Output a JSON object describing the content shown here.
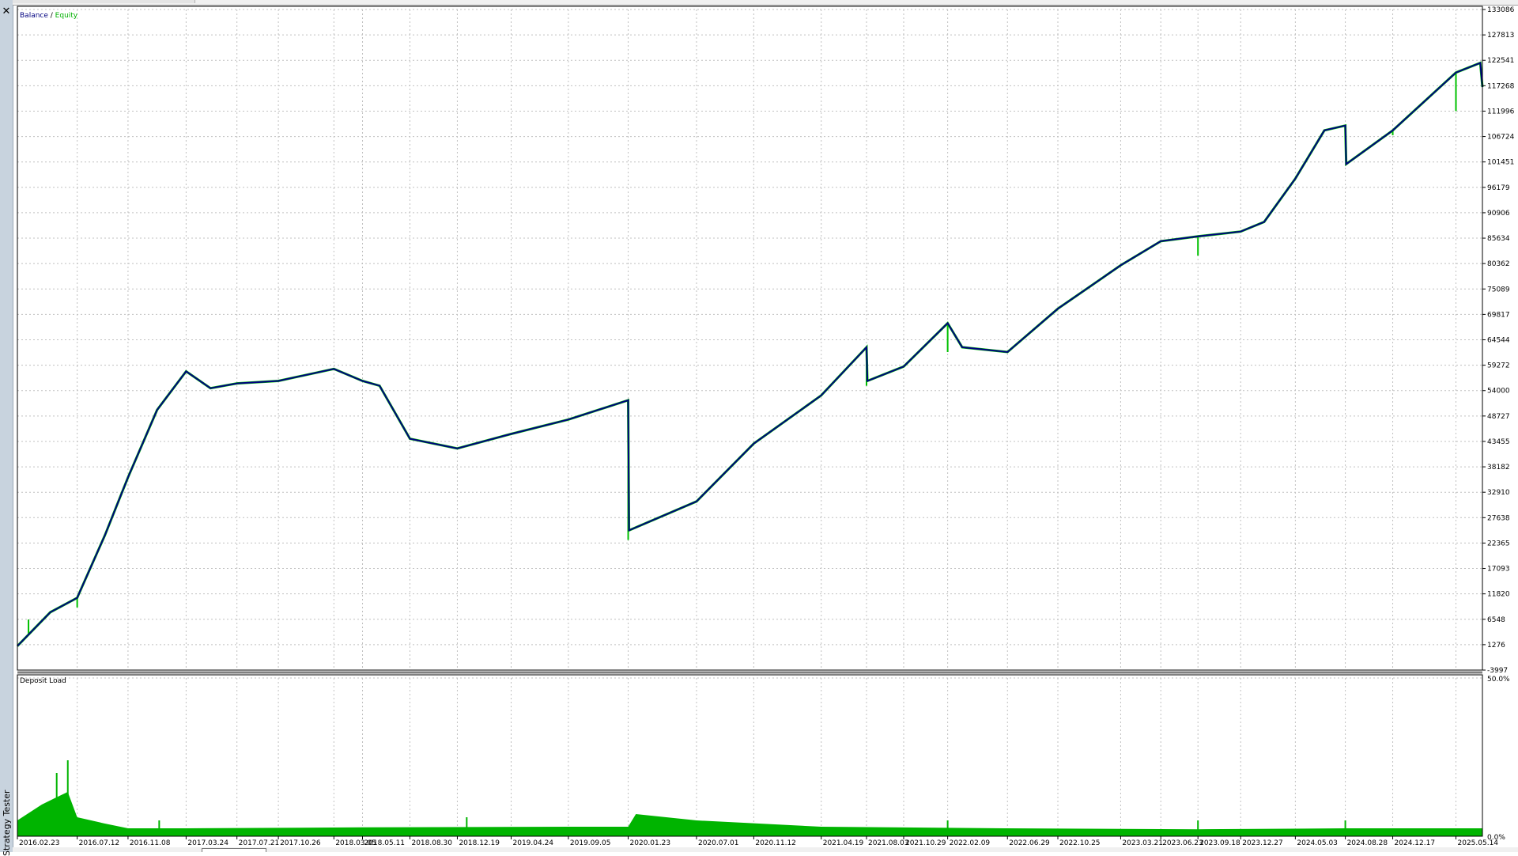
{
  "side_panel": {
    "close_glyph": "✕",
    "label": "Strategy Tester"
  },
  "legend": {
    "balance_label": "Balance",
    "separator": " / ",
    "equity_label": "Equity"
  },
  "colors": {
    "balance": "#000080",
    "equity": "#00c000",
    "grid": "#c0c0c0",
    "deposit_load": "#00b400",
    "axis_text": "#000000",
    "divider": "#808080"
  },
  "chart_data": [
    {
      "type": "line",
      "title": "",
      "series": [
        {
          "name": "Balance",
          "x": [
            "2016.02.23",
            "2016.05.10",
            "2016.07.12",
            "2016.09.15",
            "2016.11.08",
            "2017.01.15",
            "2017.03.24",
            "2017.05.20",
            "2017.07.21",
            "2017.10.26",
            "2018.03.05",
            "2018.05.11",
            "2018.06.20",
            "2018.08.30",
            "2018.12.19",
            "2019.04.24",
            "2019.09.05",
            "2020.01.23",
            "2020.01.25",
            "2020.07.01",
            "2020.11.12",
            "2021.04.19",
            "2021.08.03",
            "2021.08.05",
            "2021.10.29",
            "2022.02.09",
            "2022.03.15",
            "2022.06.29",
            "2022.10.25",
            "2023.03.21",
            "2023.06.23",
            "2023.09.18",
            "2023.12.27",
            "2024.02.20",
            "2024.05.03",
            "2024.07.10",
            "2024.08.28",
            "2024.08.30",
            "2024.12.17",
            "2025.05.14",
            "2025.07.10",
            "2025.07.15"
          ],
          "y": [
            1000,
            8000,
            11000,
            24000,
            36000,
            50000,
            58000,
            54500,
            55500,
            56000,
            58500,
            56000,
            55000,
            44000,
            42000,
            45000,
            48000,
            52000,
            25000,
            31000,
            43000,
            53000,
            63000,
            56000,
            59000,
            68000,
            63000,
            62000,
            71000,
            80000,
            85000,
            86000,
            87000,
            89000,
            98000,
            108000,
            109000,
            101000,
            108000,
            120000,
            122000,
            117000
          ]
        },
        {
          "name": "Equity",
          "dips": [
            {
              "x": "2016.03.20",
              "y": 6500
            },
            {
              "x": "2016.07.12",
              "y": 9000
            },
            {
              "x": "2020.01.23",
              "y": 23000
            },
            {
              "x": "2021.08.03",
              "y": 55000
            },
            {
              "x": "2022.02.09",
              "y": 62000
            },
            {
              "x": "2023.09.18",
              "y": 82000
            },
            {
              "x": "2024.12.17",
              "y": 107000
            },
            {
              "x": "2025.05.14",
              "y": 112000
            }
          ]
        }
      ],
      "yticks": [
        "133086",
        "127813",
        "122541",
        "117268",
        "111996",
        "106724",
        "101451",
        "96179",
        "90906",
        "85634",
        "80362",
        "75089",
        "69817",
        "64544",
        "59272",
        "54000",
        "48727",
        "43455",
        "38182",
        "32910",
        "27638",
        "22365",
        "17093",
        "11820",
        "6548",
        "1276",
        "-3997"
      ],
      "ylim": [
        -3997,
        133086
      ],
      "grid": true,
      "legend_position": "top-left"
    },
    {
      "type": "area",
      "title": "Deposit Load",
      "yticks": [
        "50.0%",
        "0.0%"
      ],
      "ylim": [
        0,
        50
      ],
      "x": [
        "2016.02.23",
        "2016.04.20",
        "2016.05.20",
        "2016.06.20",
        "2016.07.12",
        "2016.09.15",
        "2016.11.08",
        "2017.03.24",
        "2018.05.11",
        "2019.09.05",
        "2020.01.23",
        "2020.02.10",
        "2020.07.01",
        "2021.04.19",
        "2022.06.29",
        "2023.09.18",
        "2024.08.28",
        "2025.07.15"
      ],
      "y": [
        5,
        10,
        12,
        14,
        6,
        4,
        2.5,
        2.5,
        2.8,
        3,
        3,
        7,
        5,
        3,
        2.5,
        2.2,
        2.5,
        2.5
      ],
      "spikes": [
        {
          "x": "2016.06.20",
          "y": 24
        },
        {
          "x": "2016.05.25",
          "y": 20
        },
        {
          "x": "2017.01.20",
          "y": 5
        },
        {
          "x": "2019.01.10",
          "y": 6
        },
        {
          "x": "2022.02.09",
          "y": 5
        },
        {
          "x": "2023.09.18",
          "y": 5
        },
        {
          "x": "2024.08.28",
          "y": 5
        }
      ]
    }
  ],
  "x_axis_labels": [
    "2016.02.23",
    "2016.07.12",
    "2016.11.08",
    "2017.03.24",
    "2017.07.21",
    "2017.10.26",
    "2018.03.05",
    "2018.05.11",
    "2018.08.30",
    "2018.12.19",
    "2019.04.24",
    "2019.09.05",
    "2020.01.23",
    "2020.07.01",
    "2020.11.12",
    "2021.04.19",
    "2021.08.03",
    "2021.10.29",
    "2022.02.09",
    "2022.06.29",
    "2022.10.25",
    "2023.03.21",
    "2023.06.23",
    "2023.09.18",
    "2023.12.27",
    "2024.05.03",
    "2024.08.28",
    "2024.12.17",
    "2025.05.14"
  ],
  "deposit_label": "Deposit Load"
}
